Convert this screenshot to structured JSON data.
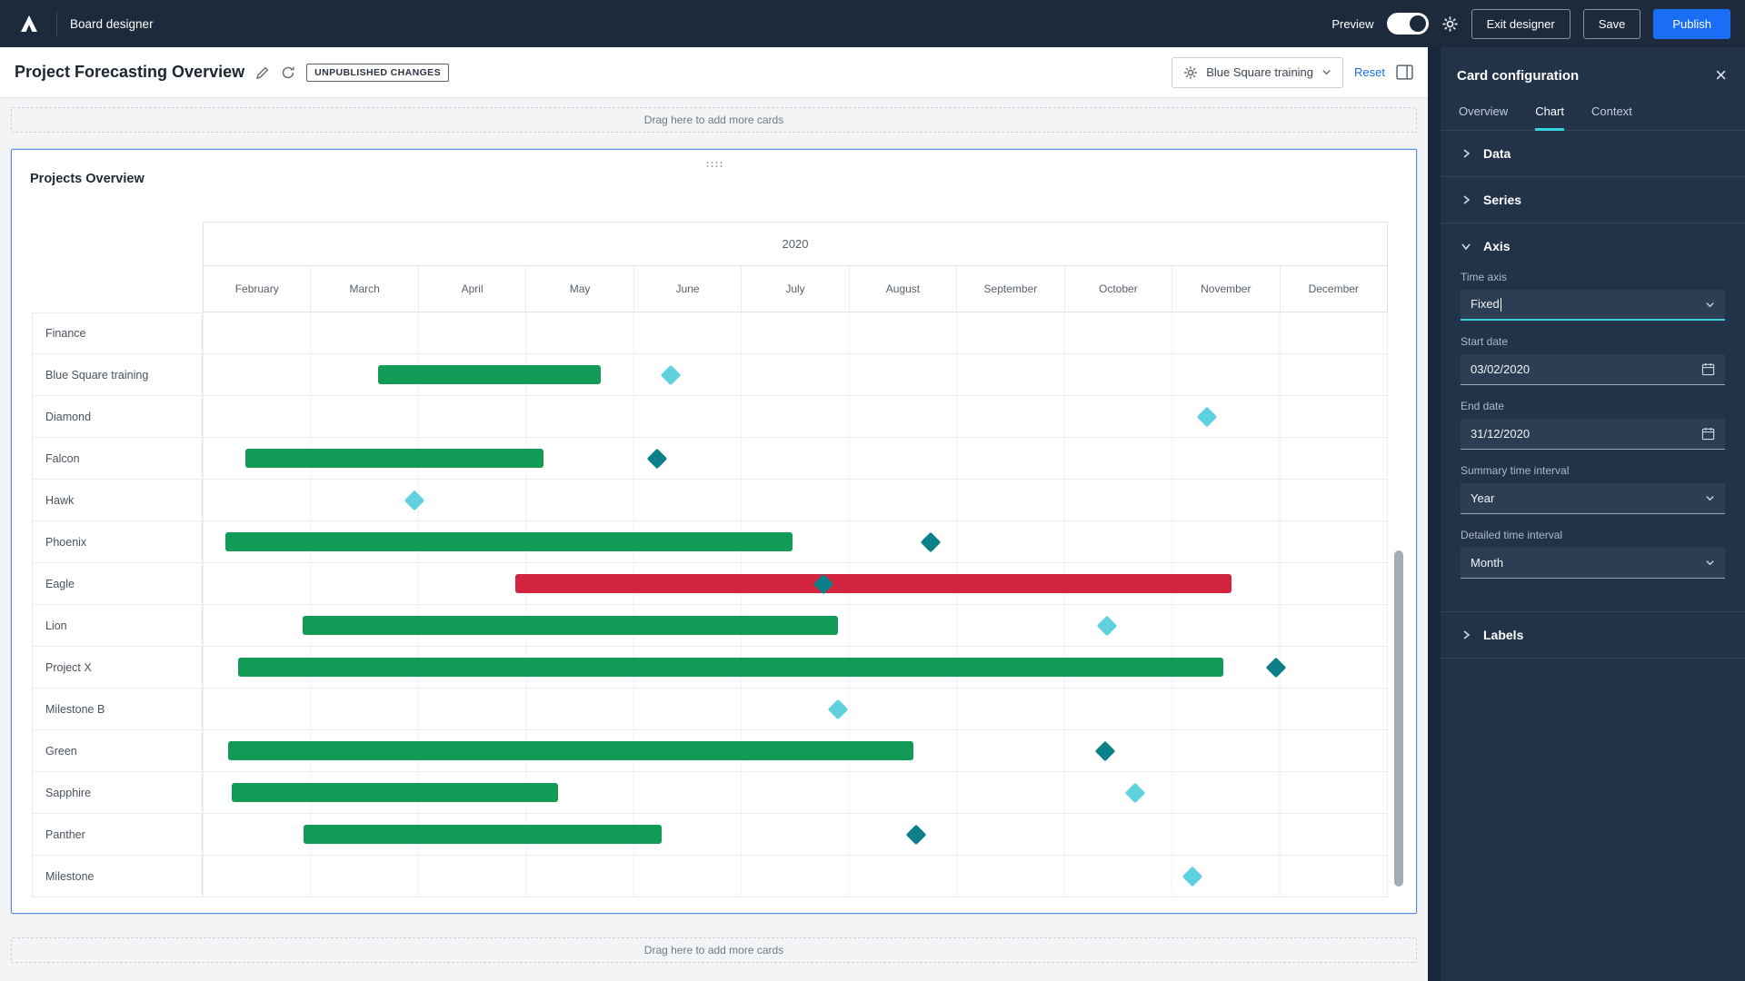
{
  "topbar": {
    "app_title": "Board designer",
    "preview_label": "Preview",
    "exit_label": "Exit designer",
    "save_label": "Save",
    "publish_label": "Publish"
  },
  "subheader": {
    "title": "Project Forecasting Overview",
    "badge": "UNPUBLISHED CHANGES",
    "context_selector": "Blue Square training",
    "reset_label": "Reset"
  },
  "dropzones": {
    "top": "Drag here to add more cards",
    "bottom": "Drag here to add more cards"
  },
  "card": {
    "title": "Projects Overview"
  },
  "colors": {
    "green": "#129b56",
    "red": "#d2243f",
    "cyan": "#5fd0de",
    "teal": "#0d7f8a",
    "accent_blue": "#1a6ef5",
    "tab_teal": "#38d3de"
  },
  "chart_data": {
    "type": "gantt",
    "title": "Projects Overview",
    "year": "2020",
    "months": [
      "February",
      "March",
      "April",
      "May",
      "June",
      "July",
      "August",
      "September",
      "October",
      "November",
      "December"
    ],
    "rows": [
      {
        "label": "Finance"
      },
      {
        "label": "Blue Square training",
        "bar": {
          "start": 1.63,
          "end": 3.7,
          "color": "green"
        },
        "milestone": {
          "pos": 4.35,
          "color": "cyan"
        }
      },
      {
        "label": "Diamond",
        "milestone": {
          "pos": 9.33,
          "color": "cyan"
        }
      },
      {
        "label": "Falcon",
        "bar": {
          "start": 0.4,
          "end": 3.17,
          "color": "green"
        },
        "milestone": {
          "pos": 4.22,
          "color": "teal"
        }
      },
      {
        "label": "Hawk",
        "milestone": {
          "pos": 1.97,
          "color": "cyan"
        }
      },
      {
        "label": "Phoenix",
        "bar": {
          "start": 0.21,
          "end": 5.48,
          "color": "green"
        },
        "milestone": {
          "pos": 6.76,
          "color": "teal"
        }
      },
      {
        "label": "Eagle",
        "bar": {
          "start": 2.9,
          "end": 9.56,
          "color": "red"
        },
        "milestone": {
          "pos": 5.77,
          "color": "teal"
        }
      },
      {
        "label": "Lion",
        "bar": {
          "start": 0.93,
          "end": 5.9,
          "color": "green"
        },
        "milestone": {
          "pos": 8.4,
          "color": "cyan"
        }
      },
      {
        "label": "Project X",
        "bar": {
          "start": 0.33,
          "end": 9.48,
          "color": "green"
        },
        "milestone": {
          "pos": 9.97,
          "color": "teal"
        }
      },
      {
        "label": "Milestone B",
        "milestone": {
          "pos": 5.9,
          "color": "cyan"
        }
      },
      {
        "label": "Green",
        "bar": {
          "start": 0.24,
          "end": 6.6,
          "color": "green"
        },
        "milestone": {
          "pos": 8.38,
          "color": "teal"
        }
      },
      {
        "label": "Sapphire",
        "bar": {
          "start": 0.27,
          "end": 3.3,
          "color": "green"
        },
        "milestone": {
          "pos": 8.66,
          "color": "cyan"
        }
      },
      {
        "label": "Panther",
        "bar": {
          "start": 0.94,
          "end": 4.26,
          "color": "green"
        },
        "milestone": {
          "pos": 6.63,
          "color": "teal"
        }
      },
      {
        "label": "Milestone",
        "milestone": {
          "pos": 9.19,
          "color": "cyan"
        }
      }
    ]
  },
  "panel": {
    "title": "Card configuration",
    "tabs": [
      {
        "label": "Overview",
        "active": false
      },
      {
        "label": "Chart",
        "active": true
      },
      {
        "label": "Context",
        "active": false
      }
    ],
    "sections": {
      "data": {
        "label": "Data"
      },
      "series": {
        "label": "Series"
      },
      "axis": {
        "label": "Axis"
      },
      "labels": {
        "label": "Labels"
      }
    },
    "axis_fields": [
      {
        "label": "Time axis",
        "value": "Fixed",
        "type": "select",
        "focused": true
      },
      {
        "label": "Start date",
        "value": "03/02/2020",
        "type": "date"
      },
      {
        "label": "End date",
        "value": "31/12/2020",
        "type": "date"
      },
      {
        "label": "Summary time interval",
        "value": "Year",
        "type": "select"
      },
      {
        "label": "Detailed time interval",
        "value": "Month",
        "type": "select"
      }
    ]
  }
}
